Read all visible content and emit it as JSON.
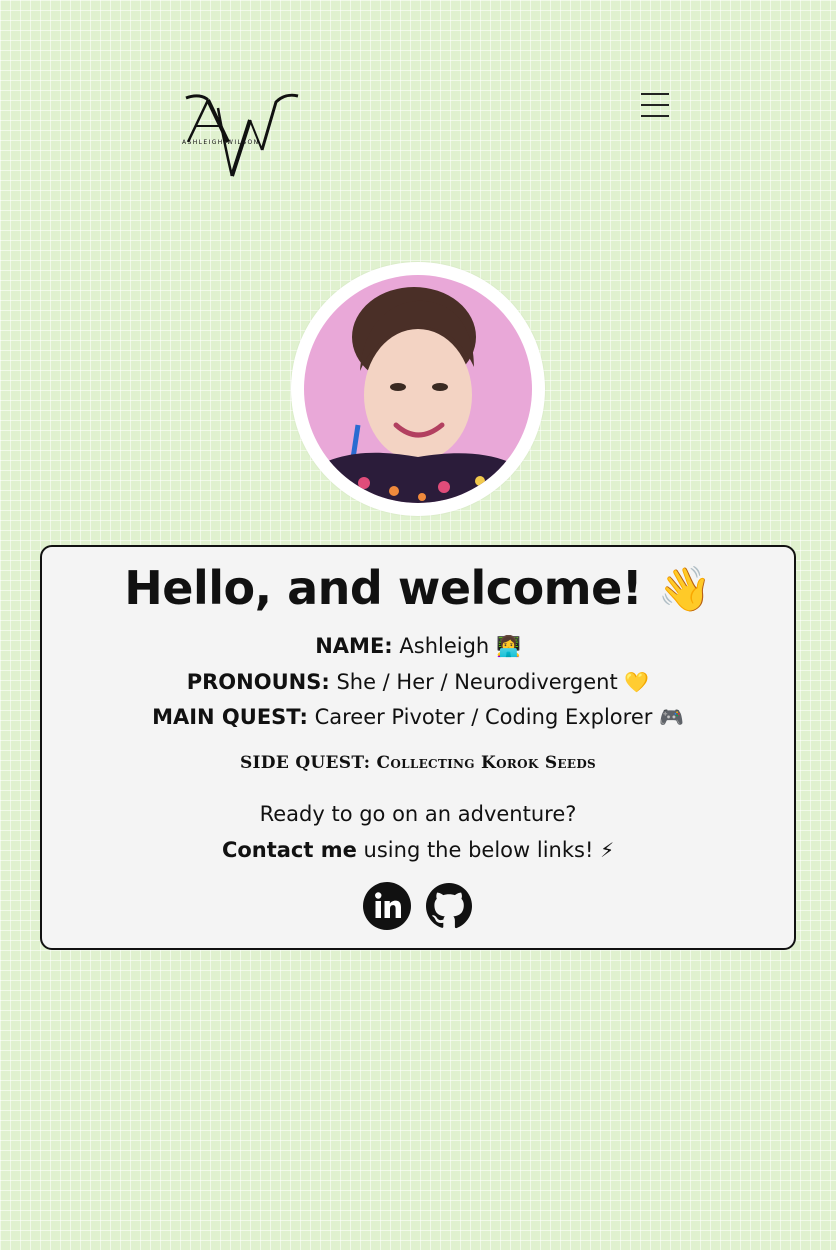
{
  "header": {
    "logo_monogram": "AW",
    "logo_text": "ASHLEIGH WILSON",
    "menu_icon": "hamburger-menu-icon"
  },
  "profile": {
    "avatar_icon": "profile-photo"
  },
  "card": {
    "title": "Hello, and welcome!",
    "title_emoji": "👋",
    "name_key": "NAME:",
    "name_value": "Ashleigh",
    "name_emoji": "👩‍💻",
    "pronouns_key": "PRONOUNS:",
    "pronouns_value": "She / Her / Neurodivergent",
    "pronouns_emoji": "💛",
    "main_quest_key": "MAIN QUEST:",
    "main_quest_value": "Career Pivoter / Coding Explorer",
    "main_quest_emoji": "🎮",
    "side_quest": "SIDE QUEST: Collecting Korok Seeds",
    "cta_line1": "Ready to go on an adventure?",
    "cta_strong": "Contact me",
    "cta_rest": "using the below links!",
    "cta_emoji": "⚡"
  },
  "social": {
    "linkedin_icon": "linkedin-icon",
    "github_icon": "github-icon"
  },
  "colors": {
    "background": "#e0f1cf",
    "card_background": "#f4f4f4",
    "avatar_background": "#e9a8d8",
    "text": "#111111"
  }
}
